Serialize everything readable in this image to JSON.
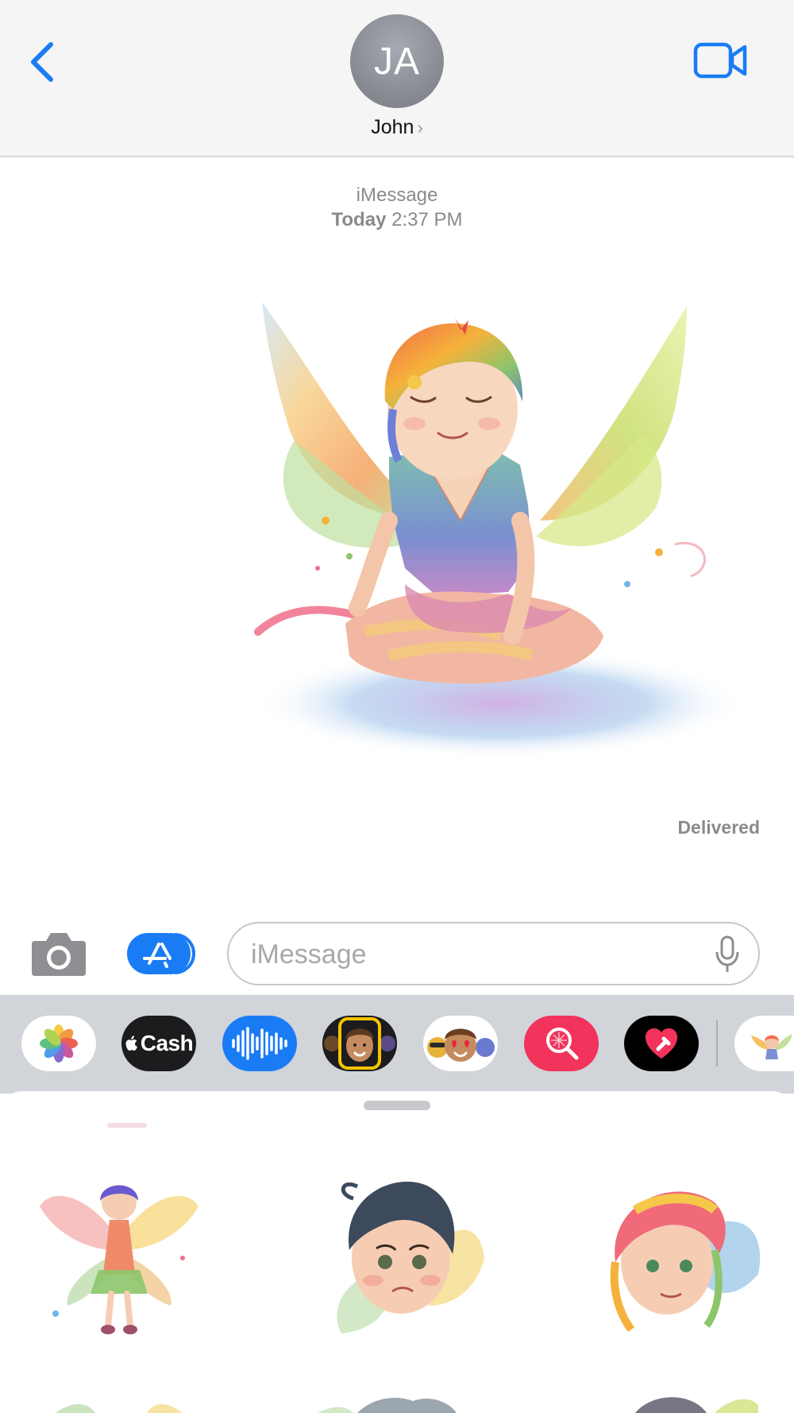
{
  "header": {
    "back_icon": "chevron-left-icon",
    "avatar_initials": "JA",
    "contact_name": "John",
    "contact_chevron": "›",
    "video_icon": "video-camera-icon"
  },
  "conversation": {
    "service_label": "iMessage",
    "time_day": "Today",
    "time_clock": "2:37 PM",
    "status": "Delivered"
  },
  "composer": {
    "camera_icon": "camera-icon",
    "apps_icon": "app-store-icon",
    "placeholder": "iMessage",
    "mic_icon": "microphone-icon"
  },
  "app_strip": {
    "apps": [
      "photos-icon",
      "Cash",
      "audio-message-icon",
      "memoji-icon",
      "animoji-icon",
      "image-search-icon",
      "digital-touch-icon",
      "sticker-pack-icon"
    ],
    "cash_label": "Cash"
  },
  "colors": {
    "accent": "#1a7cf5",
    "header_bg": "#f5f5f5",
    "strip_bg": "#d1d4d9",
    "search_red": "#f2335b"
  }
}
